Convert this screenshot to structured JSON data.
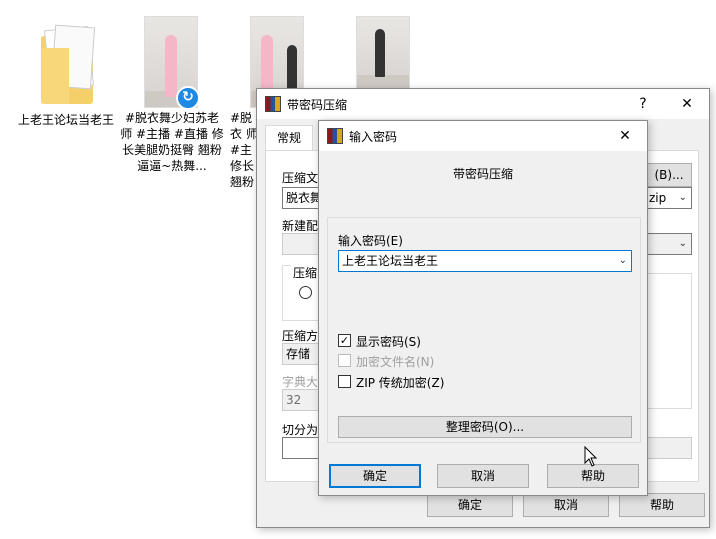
{
  "desktop": {
    "folder": {
      "label": "上老王论坛当老王"
    },
    "video1": {
      "label": "#脱衣舞少妇苏老师 #主播 #直播 修长美腿奶挺臀 翘粉逼逼~热舞..."
    },
    "video2": {
      "label": "#脱衣 师 #主 修长 翘粉"
    }
  },
  "bg_window": {
    "title": "带密码压缩",
    "help_glyph": "?",
    "close_glyph": "✕",
    "tab_general": "常规",
    "archive_label": "压缩文",
    "archive_value": "脱衣舞",
    "browse_button": "(B)...",
    "format_value": "zip",
    "new_config_label": "新建配",
    "compress_group_label": "压缩",
    "method_label": "压缩方",
    "method_value": "存储",
    "dict_label": "字典大",
    "dict_value": "32",
    "split_label": "切分为",
    "ok_button": "确定",
    "cancel_button": "取消",
    "help_button": "帮助"
  },
  "dialog": {
    "title": "输入密码",
    "close_glyph": "✕",
    "heading": "带密码压缩",
    "password_label": "输入密码(E)",
    "password_value": "上老王论坛当老王",
    "show_password": {
      "label": "显示密码(S)",
      "checked": true
    },
    "encrypt_filenames": {
      "label": "加密文件名(N)",
      "checked": false,
      "disabled": true
    },
    "zip_legacy": {
      "label": "ZIP 传统加密(Z)",
      "checked": false
    },
    "organize_button": "整理密码(O)...",
    "ok_button": "确定",
    "cancel_button": "取消",
    "help_button": "帮助"
  },
  "icons": {
    "app": "winrar-books-icon",
    "check": "✓",
    "dropdown": "chevron-down-icon"
  }
}
